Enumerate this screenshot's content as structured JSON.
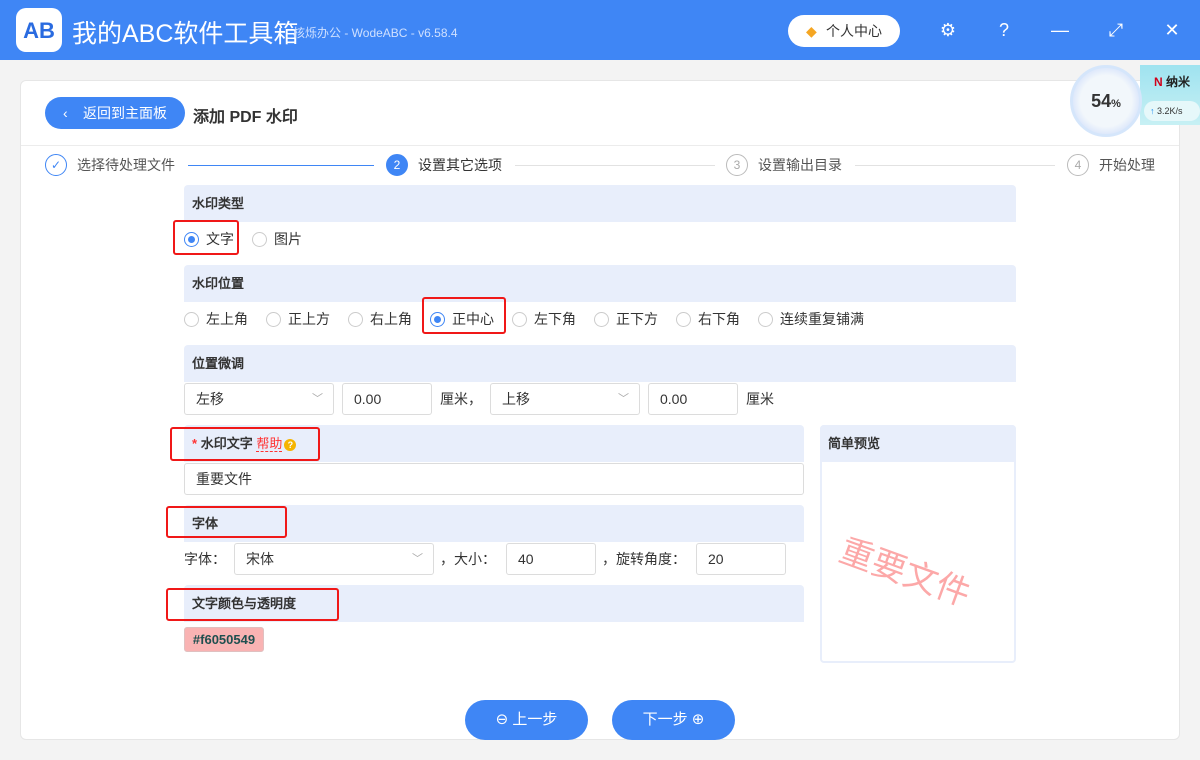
{
  "header": {
    "logo_text": "AB",
    "title": "我的ABC软件工具箱",
    "subtitle": "核烁办公 - WodeABC - v6.58.4",
    "user_center": "个人中心"
  },
  "toolbar": {
    "back": "返回到主面板",
    "page_title": "添加 PDF 水印"
  },
  "steps": [
    {
      "num": "✓",
      "label": "选择待处理文件"
    },
    {
      "num": "2",
      "label": "设置其它选项"
    },
    {
      "num": "3",
      "label": "设置输出目录"
    },
    {
      "num": "4",
      "label": "开始处理"
    }
  ],
  "type_section": {
    "title": "水印类型",
    "options": [
      "文字",
      "图片"
    ],
    "selected": "文字"
  },
  "position_section": {
    "title": "水印位置",
    "options": [
      "左上角",
      "正上方",
      "右上角",
      "正中心",
      "左下角",
      "正下方",
      "右下角",
      "连续重复铺满"
    ],
    "selected": "正中心"
  },
  "adjust_section": {
    "title": "位置微调",
    "h_dir": "左移",
    "h_value": "0.00",
    "h_unit": "厘米，",
    "v_dir": "上移",
    "v_value": "0.00",
    "v_unit": "厘米"
  },
  "text_section": {
    "required": "*",
    "title": "水印文字",
    "help": "帮助",
    "value": "重要文件"
  },
  "font_section": {
    "title": "字体",
    "font_label": "字体：",
    "font_value": "宋体",
    "size_label": "，大小：",
    "size_value": "40",
    "rotate_label": "，旋转角度：",
    "rotate_value": "20"
  },
  "color_section": {
    "title": "文字颜色与透明度",
    "value": "#f6050549",
    "color": "#f60505"
  },
  "preview": {
    "title": "简单预览",
    "text": "重要文件"
  },
  "buttons": {
    "prev": "上一步",
    "next": "下一步"
  },
  "widget": {
    "percent": "54",
    "percent_sign": "%",
    "name": "纳米",
    "speed": "3.2K/s"
  }
}
